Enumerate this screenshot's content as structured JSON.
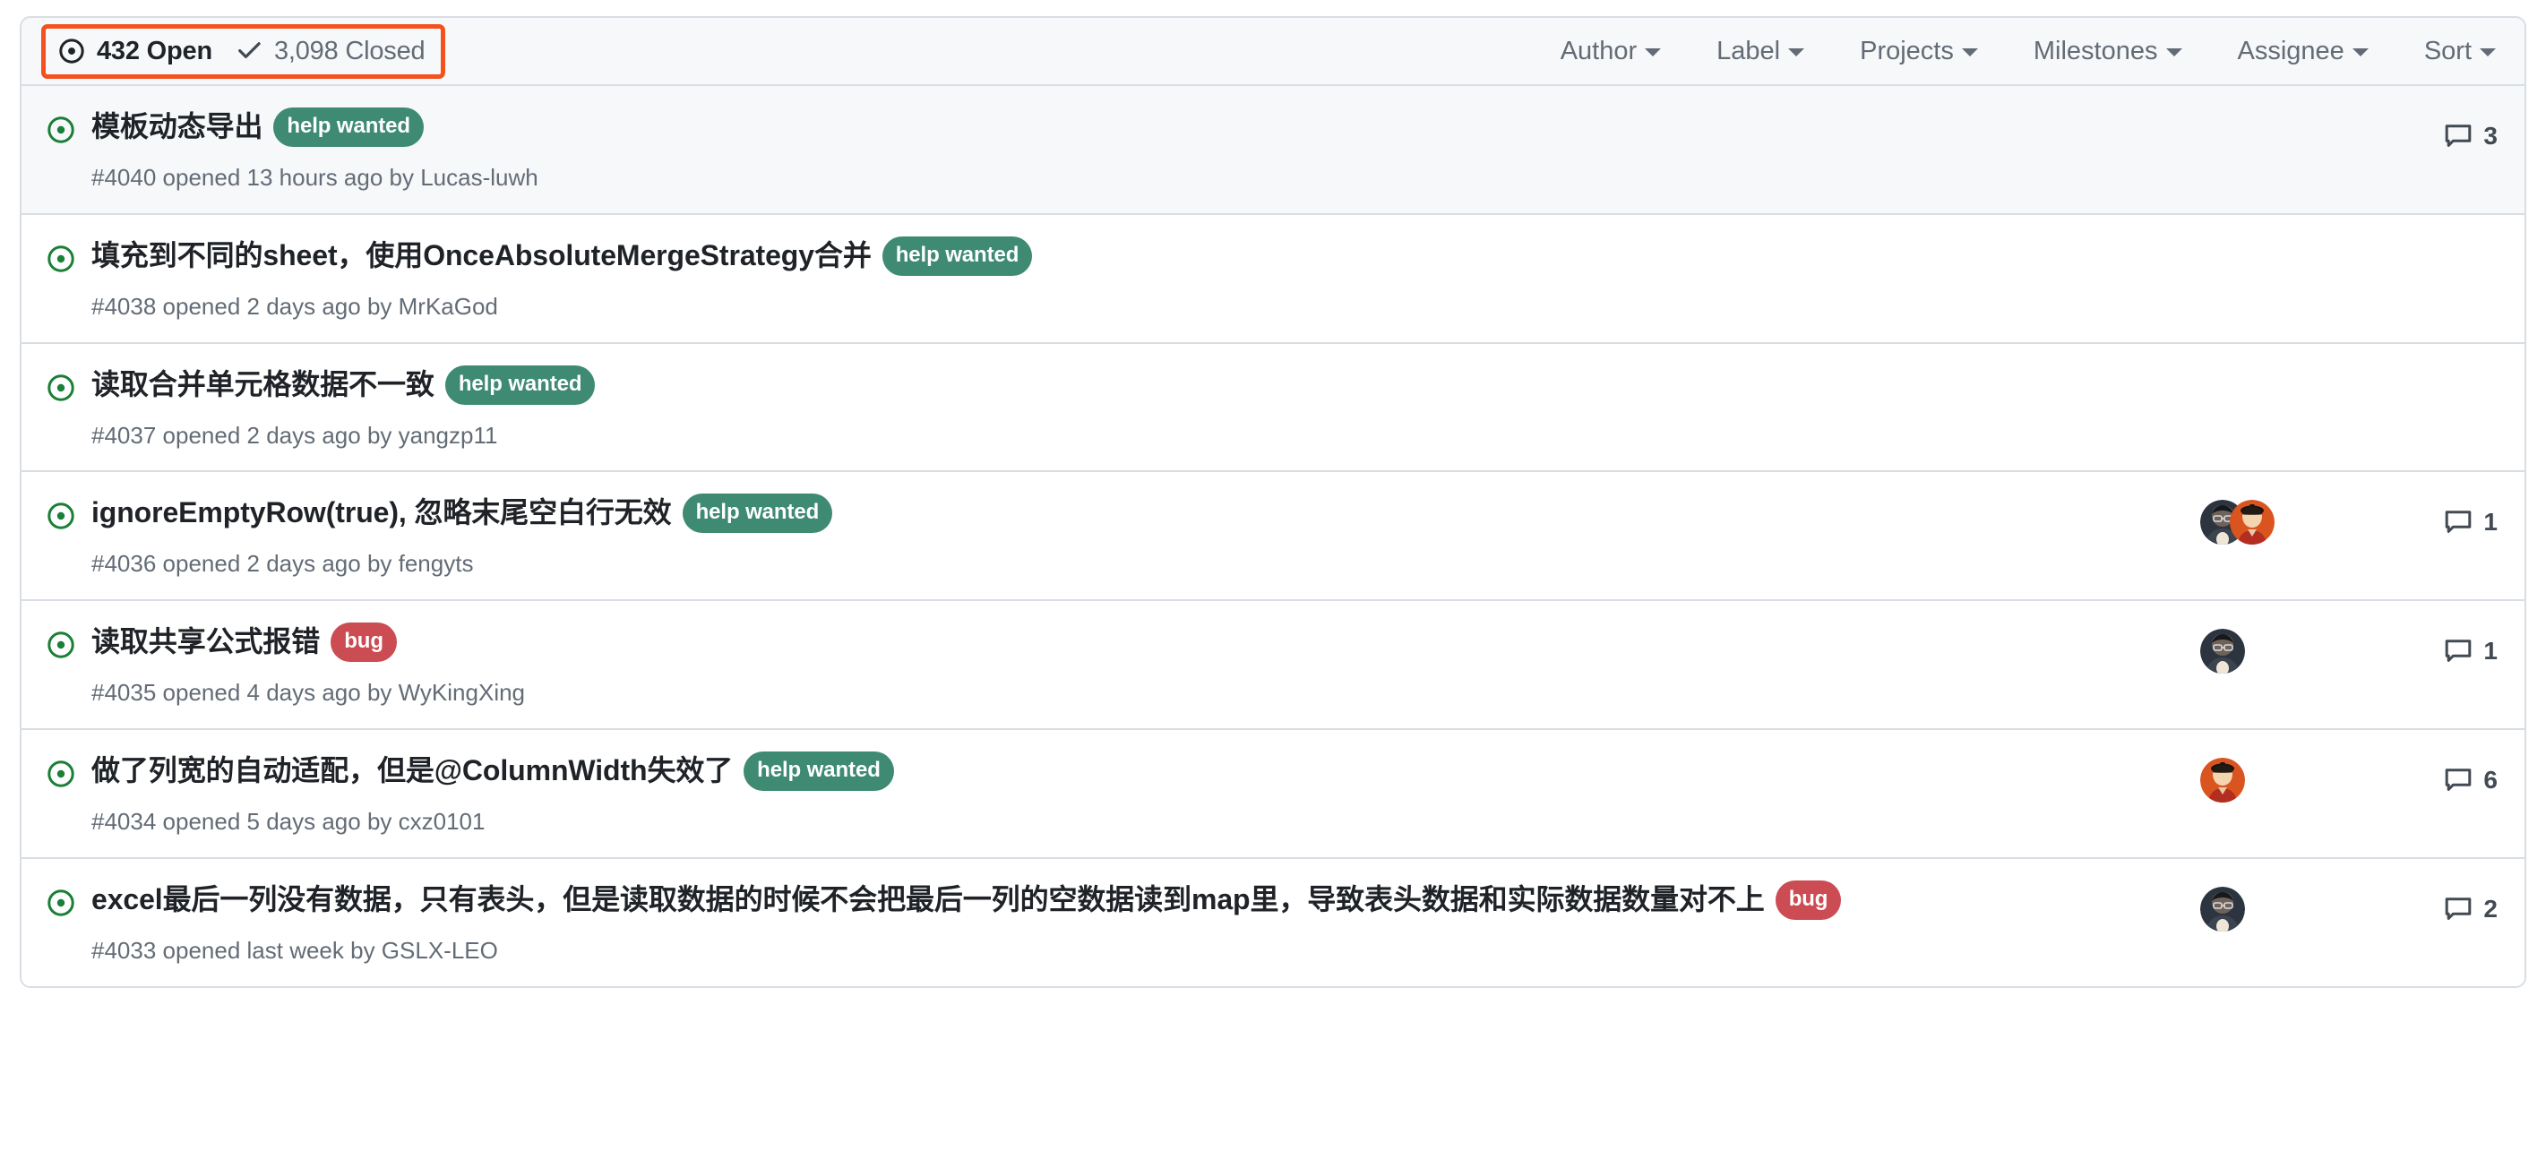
{
  "header": {
    "state_filters": [
      {
        "name": "open",
        "icon": "issue-opened-icon",
        "label": "432 Open"
      },
      {
        "name": "closed",
        "icon": "check-icon",
        "label": "3,098 Closed"
      }
    ],
    "highlight_color": "#f4511e",
    "filters": [
      {
        "name": "author",
        "label": "Author"
      },
      {
        "name": "label",
        "label": "Label"
      },
      {
        "name": "projects",
        "label": "Projects"
      },
      {
        "name": "milestones",
        "label": "Milestones"
      },
      {
        "name": "assignee",
        "label": "Assignee"
      },
      {
        "name": "sort",
        "label": "Sort"
      }
    ]
  },
  "labels_palette": {
    "help wanted": "#3e8a72",
    "bug": "#cb4c52"
  },
  "issues": [
    {
      "state_icon": "issue-opened-icon",
      "title": "模板动态导出",
      "labels": [
        "help wanted"
      ],
      "meta": "#4040 opened 13 hours ago by Lucas-luwh",
      "avatars": [],
      "comments": "3",
      "shaded": true
    },
    {
      "state_icon": "issue-opened-icon",
      "title": "填充到不同的sheet，使用OnceAbsoluteMergeStrategy合并",
      "labels": [
        "help wanted"
      ],
      "meta": "#4038 opened 2 days ago by MrKaGod",
      "avatars": [],
      "comments": "",
      "shaded": false
    },
    {
      "state_icon": "issue-opened-icon",
      "title": "读取合并单元格数据不一致",
      "labels": [
        "help wanted"
      ],
      "meta": "#4037 opened 2 days ago by yangzp11",
      "avatars": [],
      "comments": "",
      "shaded": false
    },
    {
      "state_icon": "issue-opened-icon",
      "title": "ignoreEmptyRow(true), 忽略末尾空白行无效",
      "labels": [
        "help wanted"
      ],
      "meta": "#4036 opened 2 days ago by fengyts",
      "avatars": [
        "dark",
        "orange"
      ],
      "comments": "1",
      "shaded": false
    },
    {
      "state_icon": "issue-opened-icon",
      "title": "读取共享公式报错",
      "labels": [
        "bug"
      ],
      "meta": "#4035 opened 4 days ago by WyKingXing",
      "avatars": [
        "dark"
      ],
      "comments": "1",
      "shaded": false
    },
    {
      "state_icon": "issue-opened-icon",
      "title": "做了列宽的自动适配，但是@ColumnWidth失效了",
      "labels": [
        "help wanted"
      ],
      "meta": "#4034 opened 5 days ago by cxz0101",
      "avatars": [
        "orange"
      ],
      "comments": "6",
      "shaded": false
    },
    {
      "state_icon": "issue-opened-icon",
      "title": "excel最后一列没有数据，只有表头，但是读取数据的时候不会把最后一列的空数据读到map里，导致表头数据和实际数据数量对不上",
      "labels": [
        "bug"
      ],
      "meta": "#4033 opened last week by GSLX-LEO",
      "avatars": [
        "dark"
      ],
      "comments": "2",
      "shaded": false
    }
  ]
}
